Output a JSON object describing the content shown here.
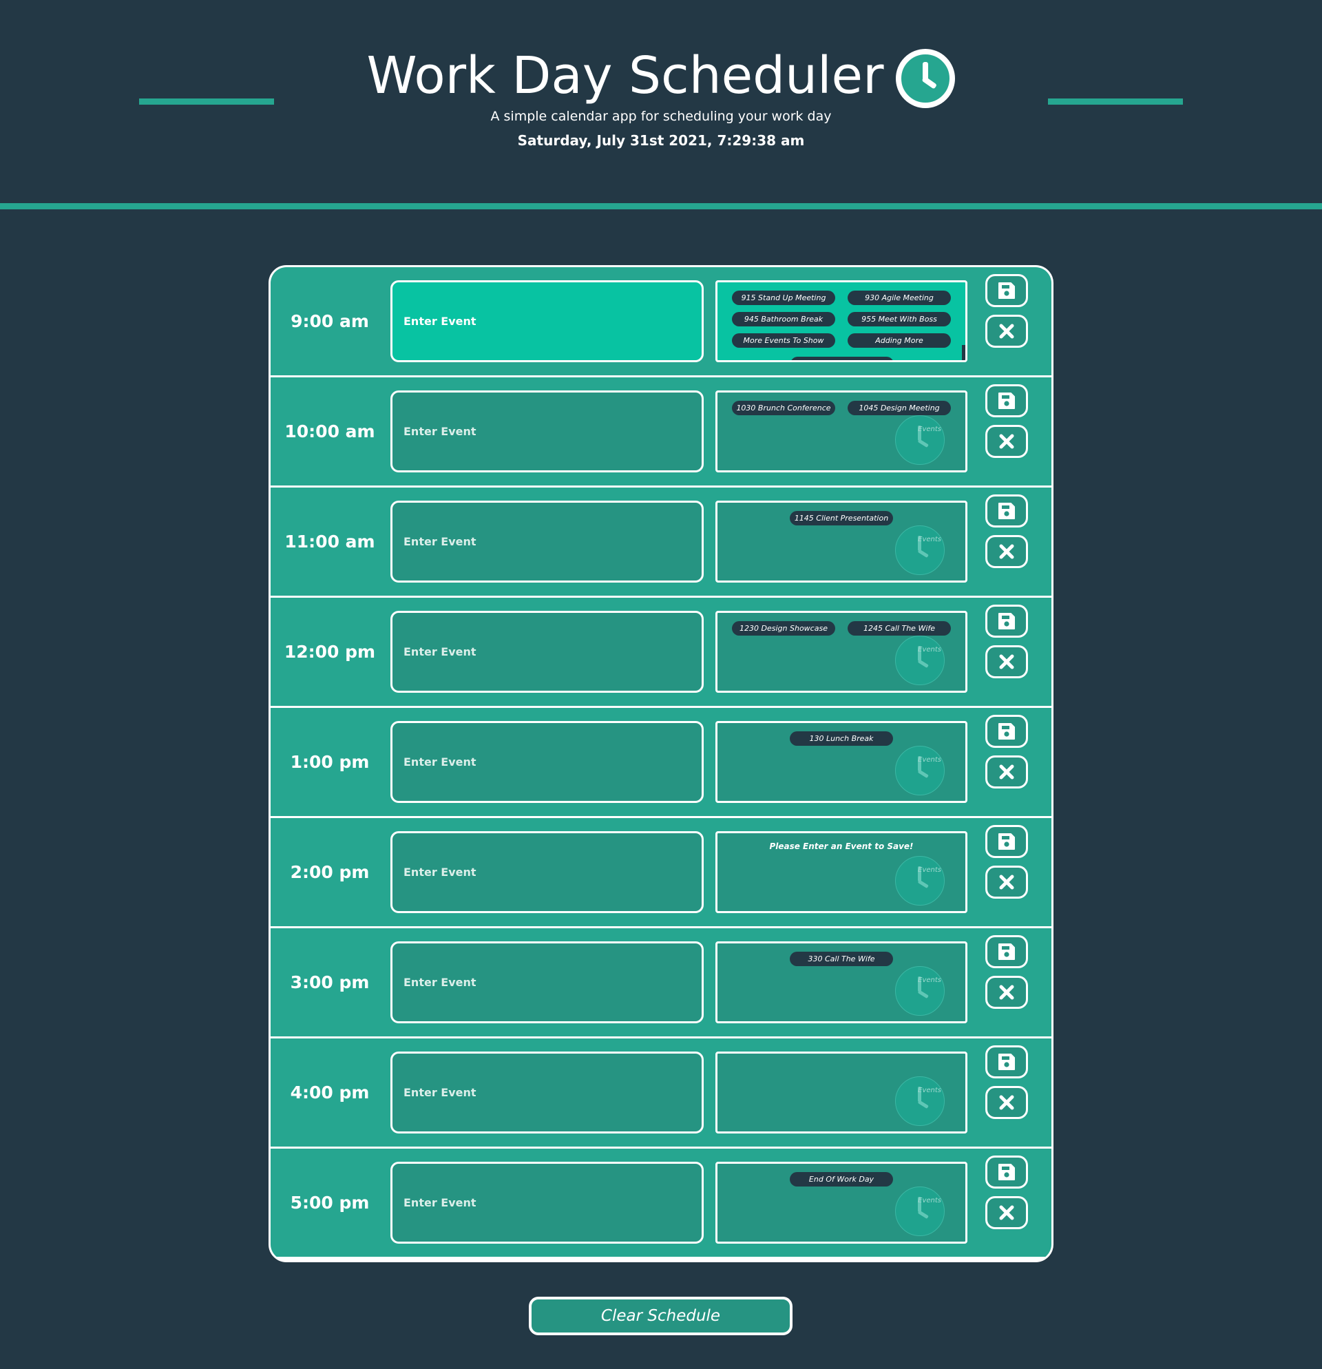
{
  "header": {
    "title": "Work Day Scheduler",
    "subtitle": "A simple calendar app for scheduling your work day",
    "datetime": "Saturday, July 31st 2021, 7:29:38 am",
    "logo_icon": "clock-icon"
  },
  "colors": {
    "background": "#233845",
    "accent": "#26a690",
    "row": "#26a690",
    "input": "#269482",
    "current_hour": "#08c3a2",
    "chip": "#233845"
  },
  "input_placeholder": "Enter Event",
  "events_watermark": "Events",
  "rows": [
    {
      "hour": "9:00 am",
      "events": [
        "915 Stand Up Meeting",
        "930 Agile Meeting",
        "945 Bathroom Break",
        "955 Meet With Boss",
        "More Events To Show",
        "Adding More"
      ]
    },
    {
      "hour": "10:00 am",
      "events": [
        "1030 Brunch Conference",
        "1045 Design Meeting"
      ]
    },
    {
      "hour": "11:00 am",
      "events": [
        "1145 Client Presentation"
      ]
    },
    {
      "hour": "12:00 pm",
      "events": [
        "1230 Design Showcase",
        "1245 Call The Wife"
      ]
    },
    {
      "hour": "1:00 pm",
      "events": [
        "130 Lunch Break"
      ]
    },
    {
      "hour": "2:00 pm",
      "events": [],
      "notice": "Please Enter an Event to Save!"
    },
    {
      "hour": "3:00 pm",
      "events": [
        "330 Call The Wife"
      ]
    },
    {
      "hour": "4:00 pm",
      "events": []
    },
    {
      "hour": "5:00 pm",
      "events": [
        "End Of Work Day"
      ]
    }
  ],
  "current_row_index": 0,
  "clear_button": {
    "label": "Clear Schedule"
  },
  "icons": {
    "save": "save-icon",
    "delete": "close-icon"
  }
}
